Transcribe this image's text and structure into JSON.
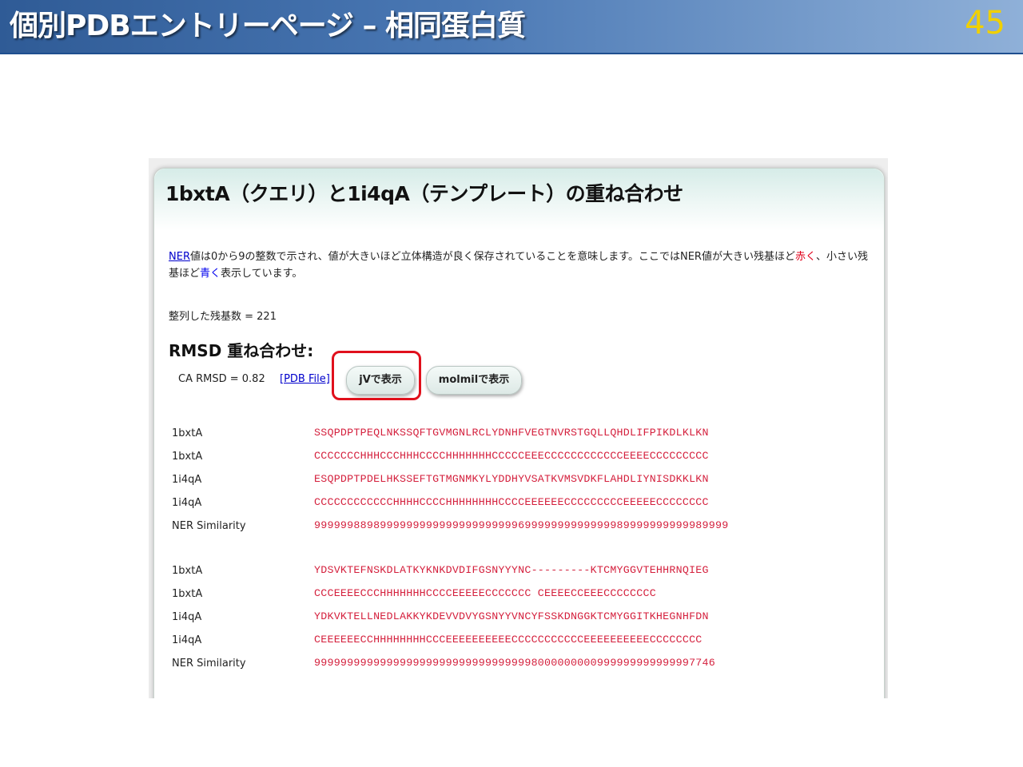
{
  "slide": {
    "title": "個別PDBエントリーページ – 相同蛋白質",
    "number": "45"
  },
  "panel": {
    "title": "1bxtA（クエリ）と1i4qA（テンプレート）の重ね合わせ",
    "desc_link": "NER",
    "desc_part1": "値は0から9の整数で示され、値が大きいほど立体構造が良く保存されていることを意味します。ここではNER値が大きい残基ほど",
    "desc_red": "赤く",
    "desc_part2": "、小さい残基ほど",
    "desc_blue": "青く",
    "desc_part3": "表示しています。",
    "aligned_count": "整列した残基数 = 221",
    "rmsd_heading": "RMSD 重ね合わせ:",
    "ca_rmsd": "CA RMSD = 0.82",
    "pdb_file_link": "[PDB File]",
    "jv_button": "jVで表示",
    "molmil_button": "molmilで表示"
  },
  "alignment": {
    "blocks": [
      {
        "rows": [
          {
            "label": "1bxtA",
            "seq": "SSQPDPTPEQLNKSSQFTGVMGNLRCLYDNHFVEGTNVRSTGQLLQHDLIFPIKDLKLKN"
          },
          {
            "label": "1bxtA",
            "seq": "CCCCCCCHHHCCCHHHCCCCHHHHHHHCCCCCEEECCCCCCCCCCCCEEEECCCCCCCCC"
          },
          {
            "label": "1i4qA",
            "seq": "ESQPDPTPDELHKSSEFTGTMGNMKYLYDDHYVSATKVMSVDKFLAHDLIYNISDKKLKN"
          },
          {
            "label": "1i4qA",
            "seq": "CCCCCCCCCCCCHHHHCCCCHHHHHHHHCCCCEEEEEECCCCCCCCCEEEEECCCCCCCC"
          },
          {
            "label": "NER Similarity",
            "seq": "999999889899999999999999999999969999999999999989999999999989999"
          }
        ]
      },
      {
        "rows": [
          {
            "label": "1bxtA",
            "seq": "YDSVKTEFNSKDLATKYKNKDVDIFGSNYYYNC---------KTCMYGGVTEHHRNQIEG"
          },
          {
            "label": "1bxtA",
            "seq": "CCCEEEECCCHHHHHHHCCCCEEEEECCCCCCC CEEEECCEEECCCCCCCC"
          },
          {
            "label": "1i4qA",
            "seq": "YDKVKTELLNEDLAKKYKDEVVDVYGSNYYVNCYFSSKDNGGKTCMYGGITKHEGNHFDN"
          },
          {
            "label": "1i4qA",
            "seq": "CEEEEEECCHHHHHHHHCCCEEEEEEEEEECCCCCCCCCCCEEEEEEEEEECCCCCCCC"
          },
          {
            "label": "NER Similarity",
            "seq": "9999999999999999999999999999999998000000000999999999999997746"
          }
        ]
      }
    ]
  },
  "colors": {
    "header_blue": "#2f5b96",
    "slide_number": "#f0d000",
    "high_ner_red": "#d41f3c",
    "low_ner_blue": "#2a2ad0",
    "highlight_box": "#e0101c"
  }
}
